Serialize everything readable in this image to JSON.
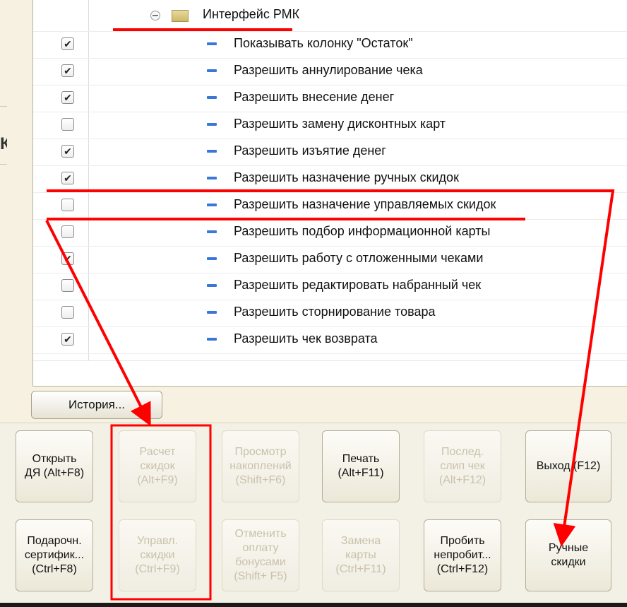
{
  "tree": {
    "group_label": "Интерфейс РМК",
    "rows": [
      {
        "label": "Показывать колонку \"Остаток\"",
        "mark": "✔"
      },
      {
        "label": "Разрешить аннулирование чека",
        "mark": "✔"
      },
      {
        "label": "Разрешить внесение денег",
        "mark": "✔"
      },
      {
        "label": "Разрешить замену дисконтных карт",
        "mark": ""
      },
      {
        "label": "Разрешить изъятие денег",
        "mark": "✔"
      },
      {
        "label": "Разрешить назначение ручных скидок",
        "mark": "✔"
      },
      {
        "label": "Разрешить назначение управляемых скидок",
        "mark": ""
      },
      {
        "label": "Разрешить подбор информационной карты",
        "mark": ""
      },
      {
        "label": "Разрешить работу с отложенными чеками",
        "mark": "✔"
      },
      {
        "label": "Разрешить редактировать набранный чек",
        "mark": ""
      },
      {
        "label": "Разрешить сторнирование товара",
        "mark": ""
      },
      {
        "label": "Разрешить чек возврата",
        "mark": "✔"
      }
    ]
  },
  "history_button": "История...",
  "left_fragment": "К",
  "tiles": {
    "open_dya": "Открыть\nДЯ (Alt+F8)",
    "calc_discounts": "Расчет\nскидок\n(Alt+F9)",
    "view_savings": "Просмотр\nнакоплений\n(Shift+F6)",
    "print": "Печать\n(Alt+F11)",
    "last_slip": "Послед.\nслип чек\n(Alt+F12)",
    "exit": "Выход (F12)",
    "gift_cert": "Подарочн.\nсертифик...\n(Ctrl+F8)",
    "managed_discounts": "Управл.\nскидки\n(Ctrl+F9)",
    "cancel_bonus": "Отменить\nоплату\nбонусами\n(Shift+ F5)",
    "replace_card": "Замена\nкарты\n(Ctrl+F11)",
    "punch_unpunched": "Пробить\nнепробит...\n(Ctrl+F12)",
    "manual_discounts": "Ручные\nскидки"
  },
  "colors": {
    "annotation": "#ff0000",
    "panel_bg": "#f6f1e0",
    "disabled_text": "#c9c2aa"
  }
}
